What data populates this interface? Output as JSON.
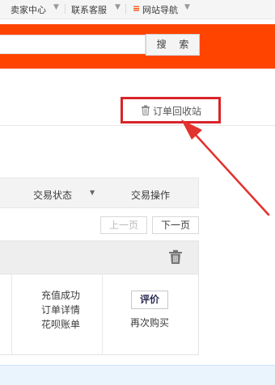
{
  "topbar": {
    "seller_center": "卖家中心",
    "customer_service": "联系客服",
    "site_nav_glyph": "≡",
    "site_nav": "网站导航"
  },
  "search": {
    "button_label": "搜 索"
  },
  "orders": {
    "recycle_bin_label": "订单回收站",
    "columns": {
      "trade_status": "交易状态",
      "trade_actions": "交易操作"
    },
    "pager": {
      "prev": "上一页",
      "next": "下一页"
    },
    "item": {
      "status_lines": [
        "充值成功",
        "订单详情",
        "花呗账单"
      ],
      "evaluate_label": "评价",
      "rebuy_label": "再次购买"
    }
  },
  "colors": {
    "brand_orange": "#ff4400",
    "annotation_red": "#d9242a"
  }
}
